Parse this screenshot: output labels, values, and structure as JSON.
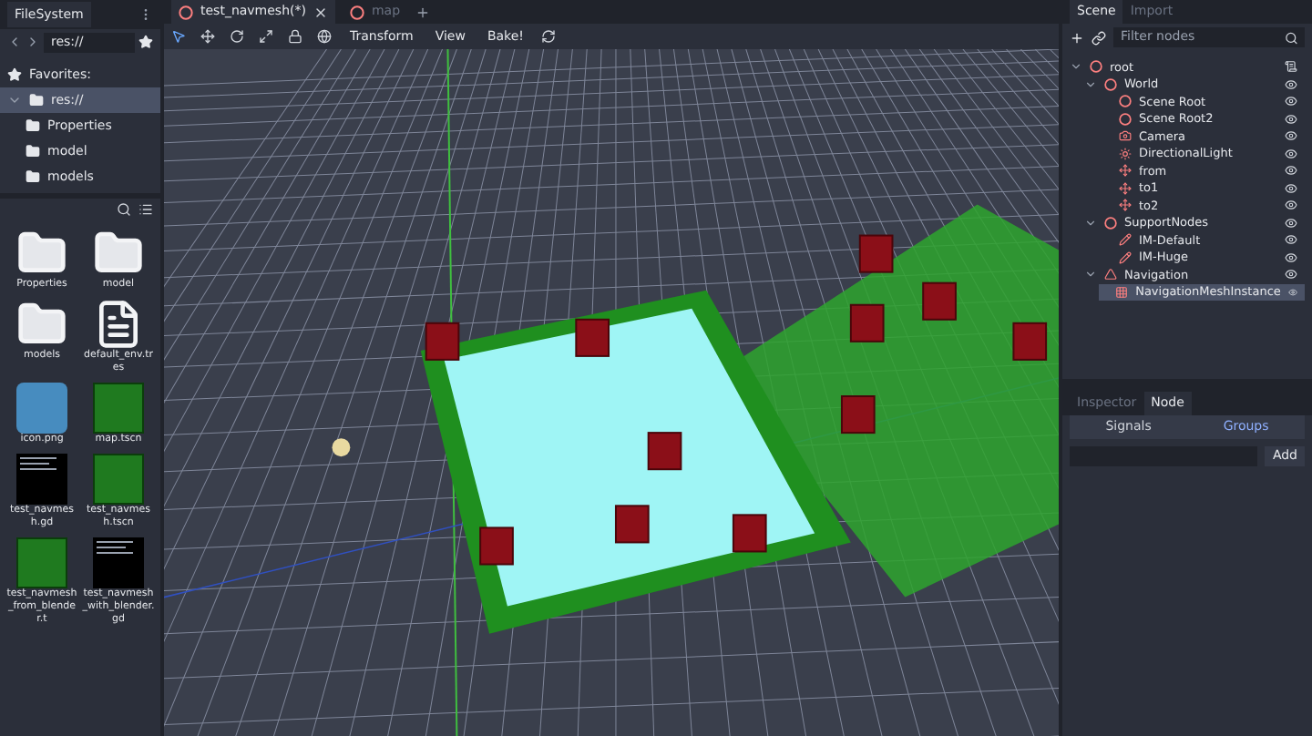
{
  "filesystem": {
    "title": "FileSystem",
    "path": "res://",
    "tree": [
      {
        "label": "Favorites:",
        "kind": "favorites",
        "selected": false
      },
      {
        "label": "res://",
        "kind": "folder",
        "selected": true,
        "expanded": true,
        "children": [
          {
            "label": "Properties",
            "kind": "folder",
            "selected": false
          },
          {
            "label": "model",
            "kind": "folder",
            "selected": false
          },
          {
            "label": "models",
            "kind": "folder",
            "selected": false
          }
        ]
      }
    ],
    "files": [
      {
        "name": "Properties",
        "kind": "folder"
      },
      {
        "name": "model",
        "kind": "folder"
      },
      {
        "name": "models",
        "kind": "folder"
      },
      {
        "name": "default_env.tres",
        "kind": "file"
      },
      {
        "name": "icon.png",
        "kind": "image"
      },
      {
        "name": "map.tscn",
        "kind": "scene"
      },
      {
        "name": "test_navmesh.gd",
        "kind": "script"
      },
      {
        "name": "test_navmesh.tscn",
        "kind": "scene"
      },
      {
        "name": "test_navmesh_from_blender.t",
        "kind": "scene"
      },
      {
        "name": "test_navmesh_with_blender.gd",
        "kind": "script"
      }
    ]
  },
  "editor_tabs": [
    {
      "label": "test_navmesh(*)",
      "selected": true
    },
    {
      "label": "map",
      "selected": false
    }
  ],
  "toolbar": {
    "menus": [
      "Transform",
      "View",
      "Bake!"
    ]
  },
  "scene": {
    "tabs": [
      {
        "label": "Scene",
        "selected": true
      },
      {
        "label": "Import",
        "selected": false
      }
    ],
    "filter": {
      "placeholder": "Filter nodes"
    },
    "tree": [
      {
        "label": "root",
        "kind": "spatial",
        "selected": false,
        "children": [
          {
            "label": "World",
            "kind": "spatial",
            "selected": false,
            "children": [
              {
                "label": "Scene Root",
                "kind": "spatial",
                "selected": false
              },
              {
                "label": "Scene Root2",
                "kind": "spatial",
                "selected": false
              },
              {
                "label": "Camera",
                "kind": "camera",
                "selected": false
              },
              {
                "label": "DirectionalLight",
                "kind": "light",
                "selected": false
              },
              {
                "label": "from",
                "kind": "position",
                "selected": false
              },
              {
                "label": "to1",
                "kind": "position",
                "selected": false
              },
              {
                "label": "to2",
                "kind": "position",
                "selected": false
              }
            ]
          },
          {
            "label": "SupportNodes",
            "kind": "spatial",
            "selected": false,
            "children": [
              {
                "label": "IM-Default",
                "kind": "geometry",
                "selected": false
              },
              {
                "label": "IM-Huge",
                "kind": "geometry",
                "selected": false
              }
            ]
          },
          {
            "label": "Navigation",
            "kind": "navigation",
            "selected": false,
            "children": [
              {
                "label": "NavigationMeshInstance",
                "kind": "navmesh",
                "selected": true
              }
            ]
          }
        ]
      }
    ]
  },
  "node_dock": {
    "tabs": [
      {
        "label": "Inspector",
        "selected": false
      },
      {
        "label": "Node",
        "selected": true
      }
    ],
    "subtabs": [
      {
        "label": "Signals",
        "selected": false
      },
      {
        "label": "Groups",
        "selected": true
      }
    ],
    "add_button": "Add"
  }
}
